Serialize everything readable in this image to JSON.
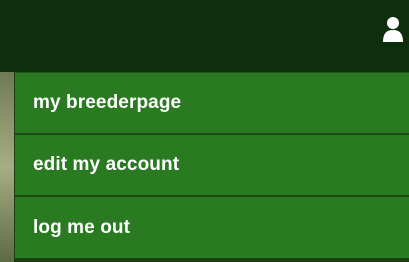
{
  "header": {
    "user_icon": "user-icon"
  },
  "menu": {
    "items": [
      {
        "label": "my breederpage"
      },
      {
        "label": "edit my account"
      },
      {
        "label": "log me out"
      }
    ]
  },
  "colors": {
    "header_bg": "#0d2f0d",
    "menu_bg": "#2a7a22",
    "menu_divider": "#1b4a17",
    "menu_text": "#ffffff"
  }
}
